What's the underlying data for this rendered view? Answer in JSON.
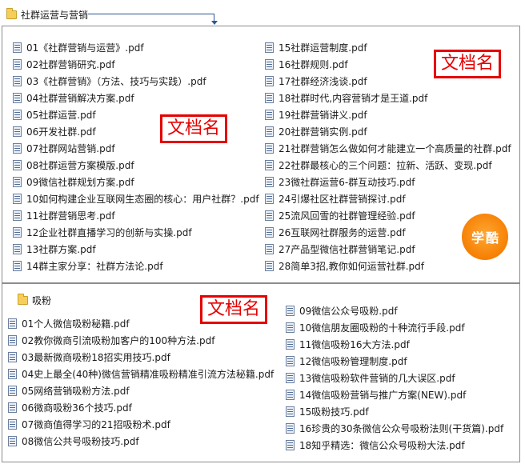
{
  "top_folder": {
    "icon": "folder-icon",
    "label": "社群运营与营销"
  },
  "section1": {
    "left_files": [
      "01《社群营销与运营》.pdf",
      "02社群营销研究.pdf",
      "03《社群营销》（方法、技巧与实践）.pdf",
      "04社群营销解决方案.pdf",
      "05社群运营.pdf",
      "06开发社群.pdf",
      "07社群网站营销.pdf",
      "08社群运营方案模版.pdf",
      "09微信社群规划方案.pdf",
      "10如何构建企业互联网生态圈的核心：用户社群？.pdf",
      "11社群营销思考.pdf",
      "12企业社群直播学习的创新与实操.pdf",
      "13社群方案.pdf",
      "14群主家分享：社群方法论.pdf"
    ],
    "right_files": [
      "15社群运营制度.pdf",
      "16社群规则.pdf",
      "17社群经济浅谈.pdf",
      "18社群时代,内容营销才是王道.pdf",
      "19社群营销讲义.pdf",
      "20社群营销实例.pdf",
      "21社群营销怎么做如何才能建立一个高质量的社群.pdf",
      "22社群最核心的三个问题：拉新、活跃、变现.pdf",
      "23微社群运营6-群互动技巧.pdf",
      "24引爆社区社群营销探讨.pdf",
      "25流风回雪的社群管理经验.pdf",
      "26互联网社群服务的运营.pdf",
      "27产品型微信社群营销笔记.pdf",
      "28简单3招,教你如何运营社群.pdf"
    ],
    "stamps": [
      "文档名",
      "文档名"
    ],
    "logo_chars": [
      "学",
      "酷"
    ]
  },
  "section2": {
    "folder": {
      "icon": "folder-icon",
      "label": "吸粉"
    },
    "left_files": [
      "01个人微信吸粉秘籍.pdf",
      "02教你微商引流吸粉加客户的100种方法.pdf",
      "03最新微商吸粉18招实用技巧.pdf",
      "04史上最全(40种)微信营销精准吸粉精准引流方法秘籍.pdf",
      "05网络营销吸粉方法.pdf",
      "06微商吸粉36个技巧.pdf",
      "07微商值得学习的21招吸粉术.pdf",
      "08微信公共号吸粉技巧.pdf"
    ],
    "right_files": [
      "09微信公众号吸粉.pdf",
      "10微信朋友圈吸粉的十种流行手段.pdf",
      "11微信吸粉16大方法.pdf",
      "12微信吸粉管理制度.pdf",
      "13微信吸粉软件营销的几大误区.pdf",
      "14微信吸粉营销与推广方案(NEW).pdf",
      "15吸粉技巧.pdf",
      "16珍贵的30条微信公众号吸粉法则(干货篇).pdf",
      "18知乎精选：微信公众号吸粉大法.pdf"
    ],
    "stamp": "文档名"
  },
  "colors": {
    "stamp_red": "#e60000",
    "connector_blue": "#2f5597",
    "logo_orange": "#f57d00",
    "folder_yellow": "#f6cf5a"
  }
}
